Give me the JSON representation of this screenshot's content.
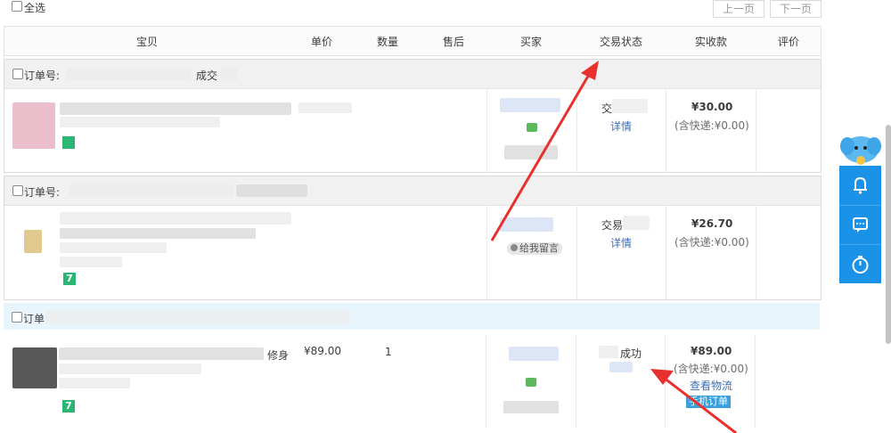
{
  "toolbar": {
    "select_all_label": "全选",
    "prev_page_label": "上一页",
    "next_page_label": "下一页"
  },
  "table": {
    "headers": [
      "宝贝",
      "单价",
      "数量",
      "售后",
      "买家",
      "交易状态",
      "实收款",
      "评价"
    ]
  },
  "orders": [
    {
      "order_label": "订单号:",
      "status_prefix": "成交",
      "status_text": "交",
      "detail_link": "详情",
      "paid": "¥30.00",
      "shipping": "(含快递:¥0.00)"
    },
    {
      "order_label": "订单号:",
      "status_text": "交易",
      "detail_link": "详情",
      "paid": "¥26.70",
      "shipping": "(含快递:¥0.00)",
      "feedback_text": "给我留言",
      "badge": "7"
    },
    {
      "order_label": "订单",
      "unit_price": "¥89.00",
      "quantity": "1",
      "item_suffix": "修身",
      "status_text": "成功",
      "paid": "¥89.00",
      "shipping": "(含快递:¥0.00)",
      "logistics_link": "查看物流",
      "mobile_tag": "手机订单",
      "badge": "7"
    }
  ],
  "side_panel": {
    "icons": [
      "mascot-icon",
      "bell-icon",
      "message-icon",
      "timer-icon"
    ]
  },
  "colors": {
    "accent": "#1a92e8",
    "link": "#3d6fb6",
    "annotation": "#e8312f"
  }
}
